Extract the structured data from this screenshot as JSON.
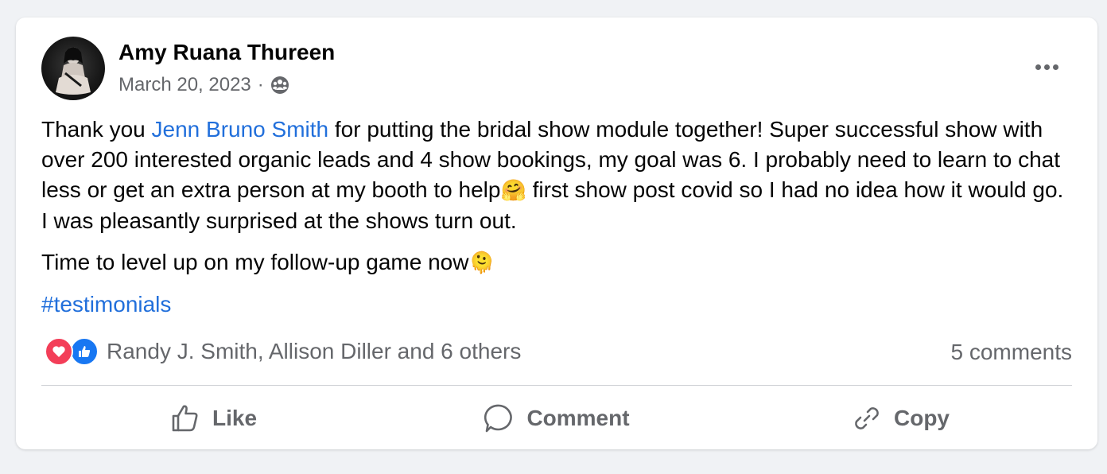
{
  "post": {
    "author": "Amy Ruana Thureen",
    "date": "March 20, 2023",
    "separator": "·",
    "audience_icon": "friends-group-icon",
    "more_icon": "more-horizontal-icon",
    "body": {
      "p1_before": "Thank you ",
      "mention": "Jenn Bruno Smith",
      "p1_after": " for putting the bridal show module together! Super successful show with over 200 interested organic leads and 4 show bookings, my goal was 6.  I probably need to learn to chat less or get an extra person at my booth to help",
      "p1_emoji": "🤗",
      "p1_end": " first show post covid so I had no idea how it would go.  I was pleasantly surprised at the shows turn out.",
      "p2": "Time to level up on my follow-up game now",
      "p2_emoji": "🫠",
      "hashtag": "#testimonials"
    },
    "reactions": {
      "types": [
        "love",
        "like"
      ],
      "summary": "Randy J. Smith, Allison Diller and 6 others"
    },
    "comments_count": "5 comments",
    "actions": {
      "like": "Like",
      "comment": "Comment",
      "copy": "Copy"
    }
  },
  "colors": {
    "link": "#216fdb",
    "secondary_text": "#65676b",
    "love": "#f33e58",
    "like": "#1877f2"
  }
}
